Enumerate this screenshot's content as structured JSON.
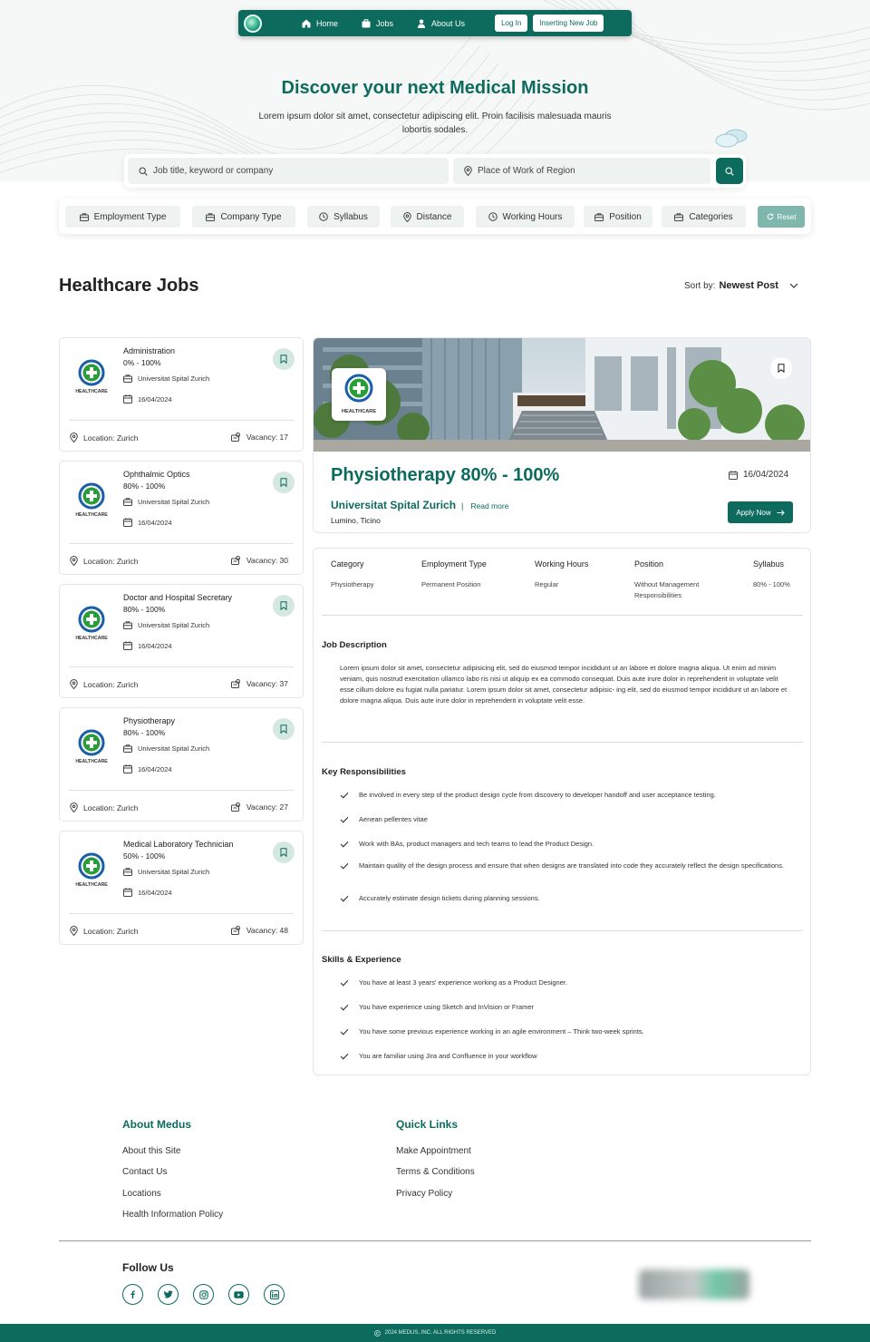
{
  "nav": {
    "items": [
      {
        "label": "Home",
        "icon": "home-icon"
      },
      {
        "label": "Jobs",
        "icon": "briefcase-icon"
      },
      {
        "label": "About Us",
        "icon": "user-icon"
      }
    ],
    "login_label": "Log In",
    "new_job_label": "Inserting New Job"
  },
  "hero": {
    "title": "Discover your next Medical Mission",
    "subtitle": "Lorem ipsum dolor sit amet, consectetur adipiscing elit. Proin facilisis malesuada mauris lobortis sodales."
  },
  "search": {
    "keyword_placeholder": "Job title, keyword or company",
    "location_placeholder": "Place of Work of Region"
  },
  "filters": [
    "Employment Type",
    "Company Type",
    "Syllabus",
    "Distance",
    "Working Hours",
    "Position",
    "Categories"
  ],
  "reset_label": "Reset",
  "section_title": "Healthcare Jobs",
  "sort": {
    "label": "Sort by:",
    "value": "Newest Post"
  },
  "logo_text": "HEALTHCARE",
  "jobs": [
    {
      "title": "Administration",
      "workload": "0% - 100%",
      "org": "Universitat Spital Zurich",
      "date": "16/04/2024",
      "location": "Location: Zurich",
      "vacancy": "Vacancy: 17"
    },
    {
      "title": "Ophthalmic Optics",
      "workload": "80% - 100%",
      "org": "Universitat Spital Zurich",
      "date": "16/04/2024",
      "location": "Location: Zurich",
      "vacancy": "Vacancy: 30"
    },
    {
      "title": "Doctor and Hospital Secretary",
      "workload": "80% - 100%",
      "org": "Universitat Spital Zurich",
      "date": "16/04/2024",
      "location": "Location: Zurich",
      "vacancy": "Vacancy: 37"
    },
    {
      "title": "Physiotherapy",
      "workload": "80% - 100%",
      "org": "Universitat Spital Zurich",
      "date": "16/04/2024",
      "location": "Location: Zurich",
      "vacancy": "Vacancy: 27"
    },
    {
      "title": "Medical Laboratory Technician",
      "workload": "50% - 100%",
      "org": "Universitat Spital Zurich",
      "date": "16/04/2024",
      "location": "Location: Zurich",
      "vacancy": "Vacancy: 48"
    }
  ],
  "detail": {
    "title": "Physiotherapy 80% - 100%",
    "date": "16/04/2024",
    "org": "Universitat Spital Zurich",
    "separator": "|",
    "read_more": "Read more",
    "city": "Lumino, Ticino",
    "apply_label": "Apply Now",
    "attributes": [
      {
        "label": "Category",
        "value": "Physiotherapy"
      },
      {
        "label": "Employment Type",
        "value": "Permanent Position"
      },
      {
        "label": "Working Hours",
        "value": "Regular"
      },
      {
        "label": "Position",
        "value": "Without Management Responsibilities"
      },
      {
        "label": "Syllabus",
        "value": "80% - 100%"
      }
    ],
    "description_heading": "Job Description",
    "description": "Lorem ipsum dolor sit amet, consectetur adipisicing elit, sed do eiusmod tempor incididunt ut an labore et dolore magna aliqua. Ut enim ad minim veniam, quis nostrud exercitation ullamco labo ris nisi ut aliquip ex ea commodo consequat. Duis aute irure dolor in reprehenderit in voluptate velit esse cillum dolore eu fugiat nulla pariatur. Lorem ipsum dolor sit amet, consectetur adipisic- ing elit, sed do eiusmod tempor incididunt ut an labore et dolore magna aliqua. Duis aute irure dolor in reprehenderit in voluptate velit esse.",
    "responsibilities_heading": "Key Responsibilities",
    "responsibilities": [
      "Be involved in every step of the product design cycle from discovery to developer handoff and user acceptance testing.",
      "Aenean pellentes vitae",
      "Work with BAs, product managers and tech teams to lead the Product Design.",
      "Maintain quality of the design process and ensure that when designs are translated into code they accurately reflect the design specifications.",
      "Accurately estimate design tickets during planning sessions."
    ],
    "skills_heading": "Skills & Experience",
    "skills": [
      "You have at least 3 years' experience working as a Product Designer.",
      "You have experience using Sketch and InVision or Framer",
      "You have some previous experience working in an agile environment – Think two-week sprints.",
      "You are familiar using Jira and Confluence in your workflow"
    ]
  },
  "footer": {
    "about_title": "About Medus",
    "about_links": [
      "About this Site",
      "Contact Us",
      "Locations",
      "Health Information Policy"
    ],
    "quick_title": "Quick Links",
    "quick_links": [
      "Make Appointment",
      "Terms & Conditions",
      "Privacy Policy"
    ],
    "follow_title": "Follow Us",
    "social_icons": [
      "facebook-icon",
      "twitter-icon",
      "instagram-icon",
      "youtube-icon",
      "linkedin-icon"
    ],
    "copyright": "2024 MEDUS, INC. ALL RIGHTS RESERVED"
  },
  "colors": {
    "brand": "#0d6b5e",
    "chip_bg": "#eef2f1",
    "reset_bg": "#7fb7ad"
  }
}
